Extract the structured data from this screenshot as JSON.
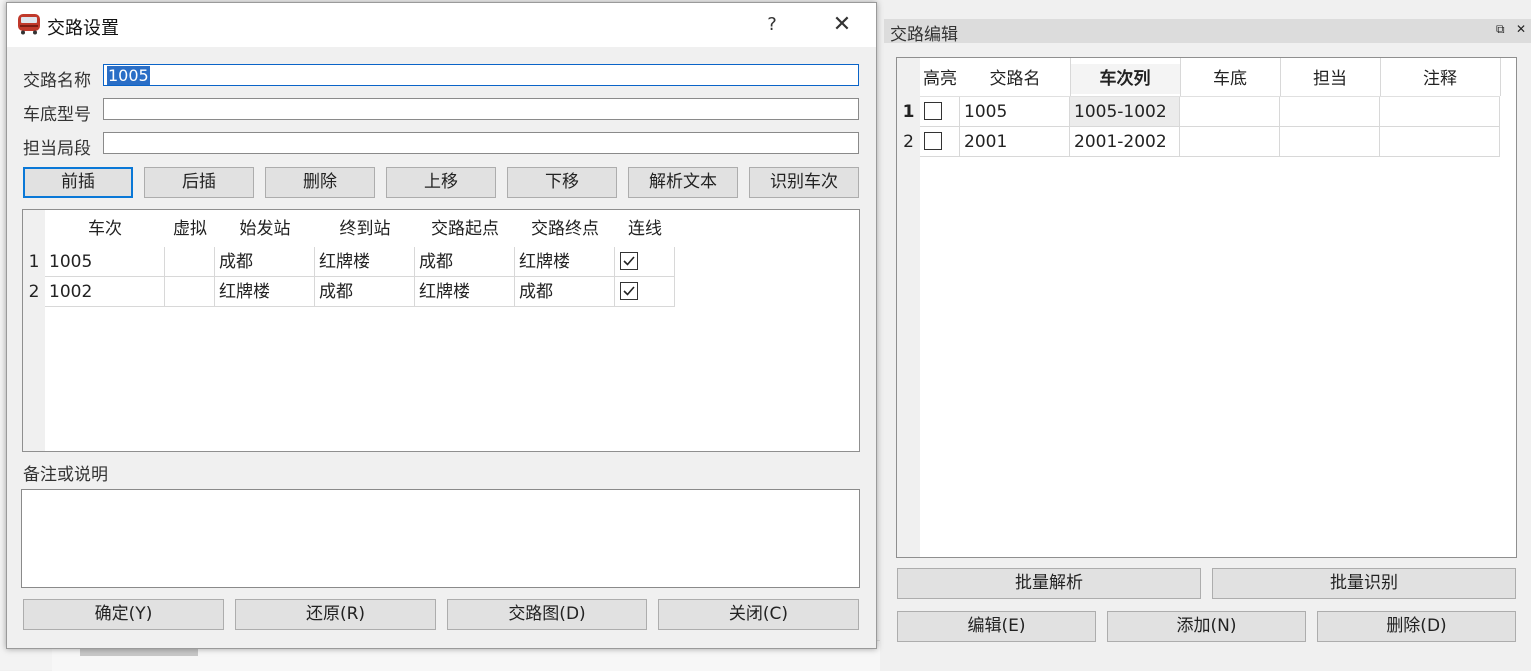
{
  "dialog": {
    "title": "交路设置",
    "help_icon": "?",
    "close_icon": "✕",
    "fields": {
      "name_label": "交路名称",
      "name_value": "1005",
      "model_label": "车底型号",
      "model_value": "",
      "bureau_label": "担当局段",
      "bureau_value": ""
    },
    "toolbar": [
      "前插",
      "后插",
      "删除",
      "上移",
      "下移",
      "解析文本",
      "识别车次"
    ],
    "table": {
      "headers": [
        "车次",
        "虚拟",
        "始发站",
        "终到站",
        "交路起点",
        "交路终点",
        "连线"
      ],
      "rows": [
        {
          "num": "1",
          "train": "1005",
          "virtual": "",
          "from": "成都",
          "to": "红牌楼",
          "start": "成都",
          "end": "红牌楼",
          "linked": true
        },
        {
          "num": "2",
          "train": "1002",
          "virtual": "",
          "from": "红牌楼",
          "to": "成都",
          "start": "红牌楼",
          "end": "成都",
          "linked": true
        }
      ]
    },
    "note_label": "备注或说明",
    "note_value": "",
    "footer": [
      "确定(Y)",
      "还原(R)",
      "交路图(D)",
      "关闭(C)"
    ]
  },
  "panel": {
    "title": "交路编辑",
    "float_icon": "⧉",
    "close_icon": "✕",
    "table": {
      "headers": [
        "高亮",
        "交路名",
        "车次列",
        "车底",
        "担当",
        "注释"
      ],
      "rows": [
        {
          "num": "1",
          "highlight": false,
          "name": "1005",
          "trains": "1005-1002",
          "model": "",
          "bureau": "",
          "note": ""
        },
        {
          "num": "2",
          "highlight": false,
          "name": "2001",
          "trains": "2001-2002",
          "model": "",
          "bureau": "",
          "note": ""
        }
      ]
    },
    "buttons_row1": [
      "批量解析",
      "批量识别"
    ],
    "buttons_row2": [
      "编辑(E)",
      "添加(N)",
      "删除(D)"
    ]
  }
}
